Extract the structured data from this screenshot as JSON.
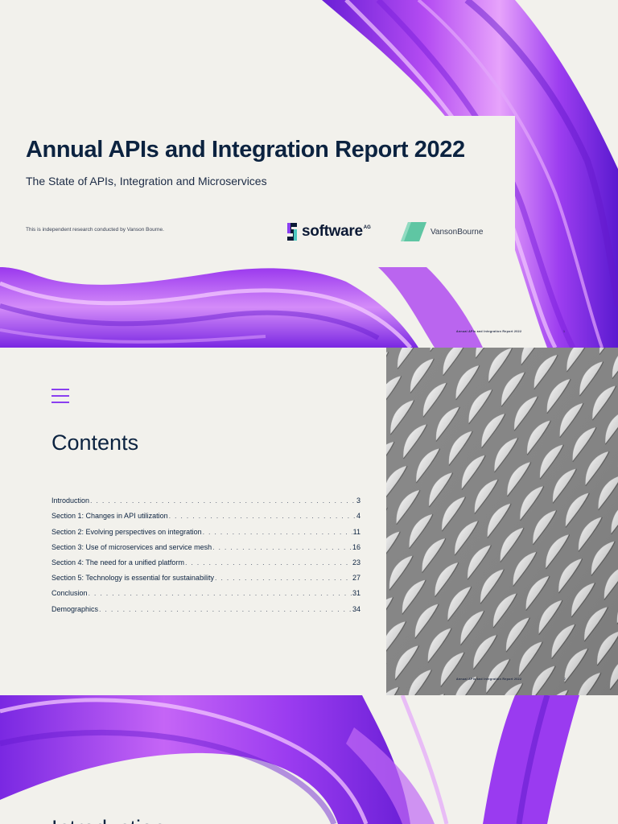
{
  "cover": {
    "title": "Annual APIs and Integration Report 2022",
    "subtitle": "The State of APIs, Integration and Microservices",
    "research_note": "This is independent research conducted by Vanson Bourne.",
    "footer_title": "Annual APIs and Integration Report 2022",
    "page_number": "1",
    "logos": {
      "software_ag_word": "software",
      "software_ag_suffix": "AG",
      "vanson_part1": "Vanson",
      "vanson_part2": "Bourne"
    }
  },
  "contents": {
    "title": "Contents",
    "footer_title": "Annual APIs and Integration Report 2022",
    "page_number": "2",
    "items": [
      {
        "label": "Introduction",
        "page": "3"
      },
      {
        "label": "Section 1: Changes in API utilization",
        "page": "4"
      },
      {
        "label": "Section 2: Evolving perspectives on integration",
        "page": "11"
      },
      {
        "label": "Section 3: Use of microservices and service mesh",
        "page": "16"
      },
      {
        "label": "Section 4: The need for a unified platform",
        "page": "23"
      },
      {
        "label": "Section 5: Technology is essential for sustainability",
        "page": "27"
      },
      {
        "label": "Conclusion",
        "page": "31"
      },
      {
        "label": "Demographics",
        "page": "34"
      }
    ]
  },
  "intro": {
    "heading": "Introduction"
  },
  "colors": {
    "background": "#f2f1ec",
    "navy": "#0c2340",
    "purple_accent": "#8a3ff0",
    "vanson_green": "#5fc6a3"
  }
}
